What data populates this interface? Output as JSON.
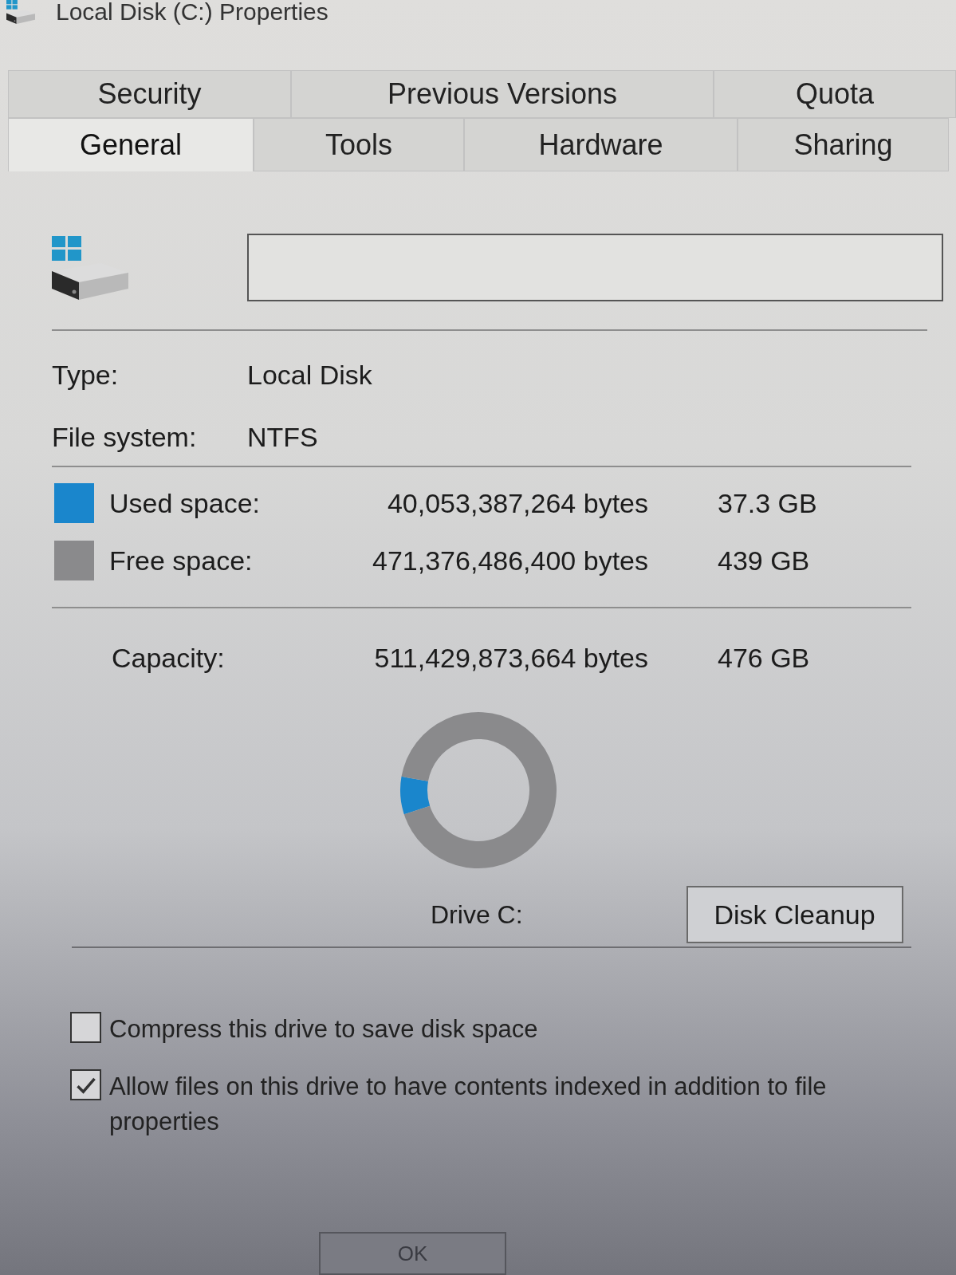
{
  "window": {
    "title": "Local Disk (C:) Properties"
  },
  "tab_rows": [
    [
      {
        "label": "Security",
        "selected": false
      },
      {
        "label": "Previous Versions",
        "selected": false
      },
      {
        "label": "Quota",
        "selected": false
      }
    ],
    [
      {
        "label": "General",
        "selected": true
      },
      {
        "label": "Tools",
        "selected": false
      },
      {
        "label": "Hardware",
        "selected": false
      },
      {
        "label": "Sharing",
        "selected": false
      }
    ]
  ],
  "info": [
    {
      "label": "Type:",
      "value": "Local Disk"
    },
    {
      "label": "File system:",
      "value": "NTFS"
    }
  ],
  "space": [
    {
      "label": "Used space:",
      "bytes": "40,053,387,264 bytes",
      "size": "37.3 GB",
      "color": "#1a86cc"
    },
    {
      "label": "Free space:",
      "bytes": "471,376,486,400 bytes",
      "size": "439 GB",
      "color": "#8a8a8c"
    }
  ],
  "capacity": {
    "label": "Capacity:",
    "bytes": "511,429,873,664 bytes",
    "size": "476 GB"
  },
  "usage_donut": {
    "level": 0.078,
    "label": "Drive C:"
  },
  "cleanup_button": "Disk Cleanup",
  "options": [
    {
      "label": "Compress this drive to save disk space",
      "checked": false
    },
    {
      "label": "Allow files on this drive to have contents indexed in addition to file properties",
      "checked": true
    }
  ],
  "buttons": [
    "OK"
  ]
}
